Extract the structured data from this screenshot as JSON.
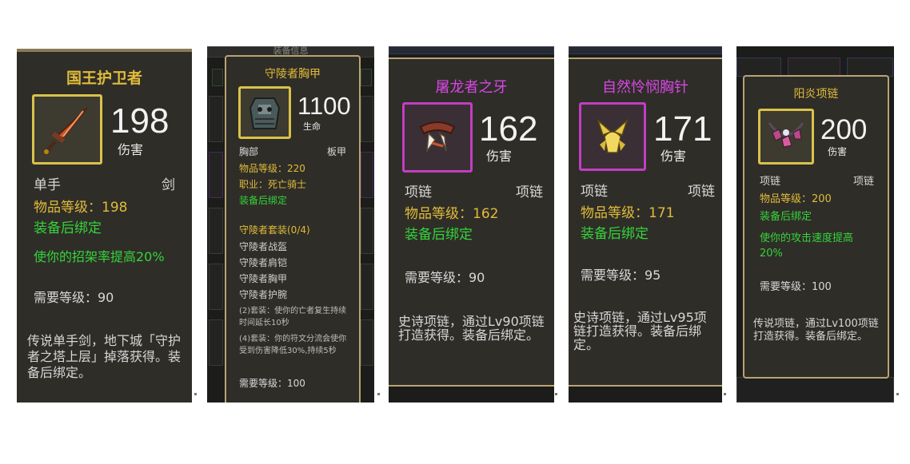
{
  "colors": {
    "gold": "#e0bc3a",
    "green": "#34d43a",
    "purple": "#d847e6",
    "border": "#b8a473"
  },
  "cards": [
    {
      "name": "国王护卫者",
      "icon": "sword-icon",
      "value": "198",
      "stat": "伤害",
      "slot": "单手",
      "type": "剑",
      "item_level": "物品等级：198",
      "bind": "装备后绑定",
      "effect": "使你的招架率提高20%",
      "req": "需要等级：90",
      "desc": "传说单手剑，地下城「守护者之塔上层」掉落获得。装备后绑定。"
    },
    {
      "name": "守陵者胸甲",
      "icon": "chest-armor-icon",
      "value": "1100",
      "stat": "生命",
      "slot": "胸部",
      "type": "板甲",
      "item_level": "物品等级：220",
      "class": "职业：死亡骑士",
      "bind": "装备后绑定",
      "set_title": "守陵者套装(0/4)",
      "set_items": [
        "守陵者战盔",
        "守陵者肩铠",
        "守陵者胸甲",
        "守陵者护腕"
      ],
      "set_bonus_2": "(2)套装：使你的亡者复生持续时间延长10秒",
      "set_bonus_4": "(4)套装：你的符文分流会使你受到伤害降低30%,持续5秒",
      "req": "需要等级：100",
      "header_fragment": "装备信息"
    },
    {
      "name": "屠龙者之牙",
      "icon": "fang-necklace-icon",
      "value": "162",
      "stat": "伤害",
      "slot": "项链",
      "type": "项链",
      "item_level": "物品等级：162",
      "bind": "装备后绑定",
      "req": "需要等级：90",
      "desc": "史诗项链，通过Lv90项链打造获得。装备后绑定。"
    },
    {
      "name": "自然怜悯胸针",
      "icon": "brooch-icon",
      "value": "171",
      "stat": "伤害",
      "slot": "项链",
      "type": "项链",
      "item_level": "物品等级：171",
      "bind": "装备后绑定",
      "req": "需要等级：95",
      "desc": "史诗项链，通过Lv95项链打造获得。装备后绑定。"
    },
    {
      "name": "阳炎项链",
      "icon": "gem-necklace-icon",
      "value": "200",
      "stat": "伤害",
      "slot": "项链",
      "type": "项链",
      "item_level": "物品等级：200",
      "bind": "装备后绑定",
      "effect": "使你的攻击速度提高20%",
      "req": "需要等级：100",
      "desc": "传说项链，通过Lv100项链打造获得。装备后绑定。"
    }
  ]
}
